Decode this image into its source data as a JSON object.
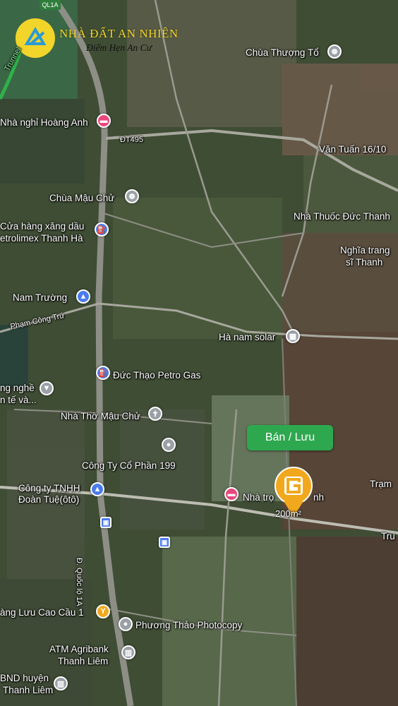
{
  "brand": {
    "name": "NHÀ ĐẤT AN NHIÊN",
    "tagline": "Điểm Hẹn An Cư"
  },
  "route_shield": "QL1A",
  "listing": {
    "action_label": "Bán / Lưu",
    "area_label": "200m²",
    "marker_icon": "g-location-pin-icon",
    "marker_color": "#f2a81d",
    "button_color": "#2ea84f"
  },
  "places": [
    {
      "id": "chua-thuong-to",
      "label": "Chùa Thượng Tổ",
      "icon": "temple-icon",
      "color": "#9aa0a6"
    },
    {
      "id": "nha-nghi-hoang-anh",
      "label": "Nhà nghỉ Hoàng Anh",
      "icon": "bed-icon",
      "color": "#e8467c"
    },
    {
      "id": "van-tuan",
      "label": "Văn Tuấn 16/10",
      "icon": "",
      "color": ""
    },
    {
      "id": "chua-mau-chu",
      "label": "Chùa Mậu Chử",
      "icon": "temple-icon",
      "color": "#9aa0a6"
    },
    {
      "id": "nha-thuoc",
      "label": "Nhà Thuốc Đức Thanh",
      "icon": "",
      "color": ""
    },
    {
      "id": "cua-hang-xang-1",
      "label": "Cửa hàng xăng dầu",
      "icon": "fuel-icon",
      "color": "#4b7bec"
    },
    {
      "id": "cua-hang-xang-2",
      "label": "etrolimex Thanh Hà",
      "icon": "",
      "color": ""
    },
    {
      "id": "nghia-trang-1",
      "label": "Nghĩa trang",
      "icon": "",
      "color": ""
    },
    {
      "id": "nghia-trang-2",
      "label": "sĩ Thanh",
      "icon": "",
      "color": ""
    },
    {
      "id": "nam-truong",
      "label": "Nam Trường",
      "icon": "shopping-bag-icon",
      "color": "#4b7bec"
    },
    {
      "id": "ha-nam-solar",
      "label": "Hà nam solar",
      "icon": "building-icon",
      "color": "#9aa0a6"
    },
    {
      "id": "duc-thao",
      "label": "Đức Thạo Petro Gas",
      "icon": "fuel-icon",
      "color": "#4b7bec"
    },
    {
      "id": "truong-nghe-1",
      "label": "ng nghề",
      "icon": "school-icon",
      "color": "#9aa0a6"
    },
    {
      "id": "truong-nghe-2",
      "label": "n tế và...",
      "icon": "",
      "color": ""
    },
    {
      "id": "nha-tho",
      "label": "Nhà Thờ Mậu Chử",
      "icon": "church-icon",
      "color": "#9aa0a6"
    },
    {
      "id": "cong-ty-199",
      "label": "Công Ty Cổ Phần 199",
      "icon": "location-icon",
      "color": "#9aa0a6"
    },
    {
      "id": "cong-ty-tnhh-1",
      "label": "Công ty TNHH",
      "icon": "shopping-bag-icon",
      "color": "#4b7bec"
    },
    {
      "id": "cong-ty-tnhh-2",
      "label": "Đoàn Tuệ(ôtô)",
      "icon": "",
      "color": ""
    },
    {
      "id": "nha-tro",
      "label": "Nhà trọ",
      "icon": "bed-icon",
      "color": "#e8467c"
    },
    {
      "id": "nha-tro-2",
      "label": "nh",
      "icon": "",
      "color": ""
    },
    {
      "id": "tram",
      "label": "Trạm",
      "icon": "",
      "color": ""
    },
    {
      "id": "tru",
      "label": "Tru",
      "icon": "",
      "color": ""
    },
    {
      "id": "quan-luu",
      "label": "àng Lưu Cao Cầu 1",
      "icon": "restaurant-icon",
      "color": "#f2a81d"
    },
    {
      "id": "phuong-thao",
      "label": "Phương Thảo Photocopy",
      "icon": "location-icon",
      "color": "#9aa0a6"
    },
    {
      "id": "atm-1",
      "label": "ATM Agribank",
      "icon": "bank-icon",
      "color": "#9aa0a6"
    },
    {
      "id": "atm-2",
      "label": "Thanh Liêm",
      "icon": "",
      "color": ""
    },
    {
      "id": "ubnd-1",
      "label": "BND huyện",
      "icon": "government-icon",
      "color": "#9aa0a6"
    },
    {
      "id": "ubnd-2",
      "label": "Thanh Liêm",
      "icon": "",
      "color": ""
    }
  ],
  "roads": [
    {
      "id": "dt495",
      "label": "ĐT495"
    },
    {
      "id": "pham-cong-tru",
      "label": "Phạm Công Trứ"
    },
    {
      "id": "quoc-lo",
      "label": "Đ. Quốc lộ 1A"
    },
    {
      "id": "trunnel",
      "label": "Trunnel"
    }
  ]
}
